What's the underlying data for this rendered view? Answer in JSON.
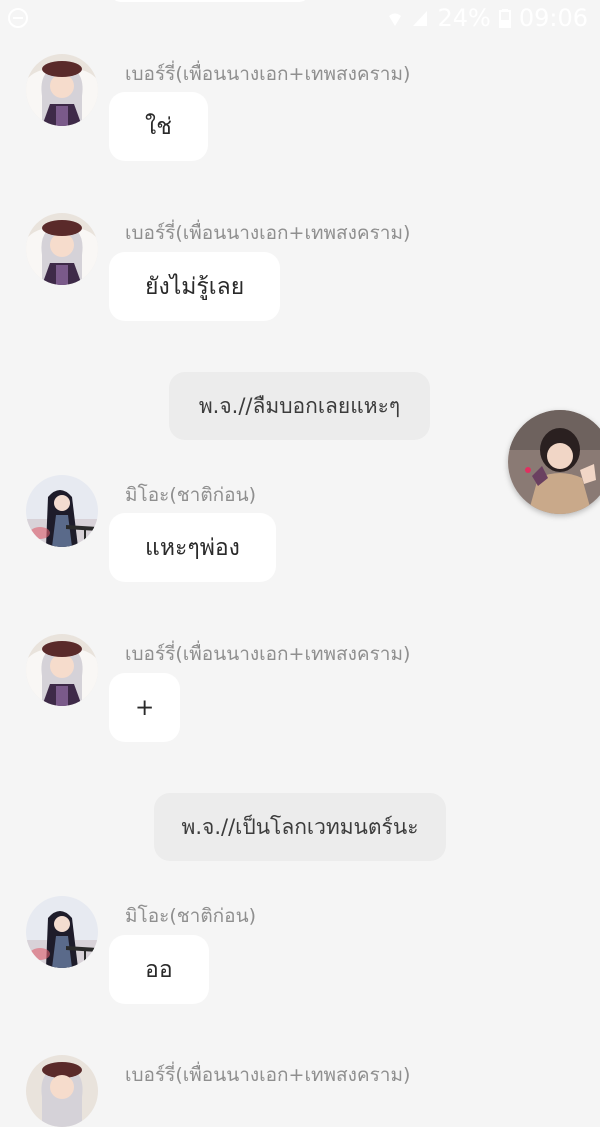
{
  "status_bar": {
    "battery": "24%",
    "time": "09:06"
  },
  "messages": [
    {
      "sender": "เบอร์รี่(เพื่อนนางเอก+เทพสงคราม)",
      "text": "ใช่",
      "avatar": "berry-avatar"
    },
    {
      "sender": "เบอร์รี่(เพื่อนนางเอก+เทพสงคราม)",
      "text": "ยังไม่รู้เลย",
      "avatar": "berry-avatar"
    },
    {
      "system": "พ.จ.//ลืมบอกเลยแหะๆ"
    },
    {
      "sender": "มิโอะ(ชาติก่อน)",
      "text": "แหะๆพ่อง",
      "avatar": "mio-avatar"
    },
    {
      "sender": "เบอร์รี่(เพื่อนนางเอก+เทพสงคราม)",
      "text": "+",
      "avatar": "berry-avatar"
    },
    {
      "system": "พ.จ.//เป็นโลกเวทมนตร์นะ"
    },
    {
      "sender": "มิโอะ(ชาติก่อน)",
      "text": "ออ",
      "avatar": "mio-avatar"
    },
    {
      "sender": "เบอร์รี่(เพื่อนนางเอก+เทพสงคราม)",
      "avatar": "berry-avatar"
    }
  ],
  "colors": {
    "background": "#f5f5f5",
    "bubble": "#ffffff",
    "system_bubble": "#ececec",
    "sender_text": "#8f8f8f"
  }
}
